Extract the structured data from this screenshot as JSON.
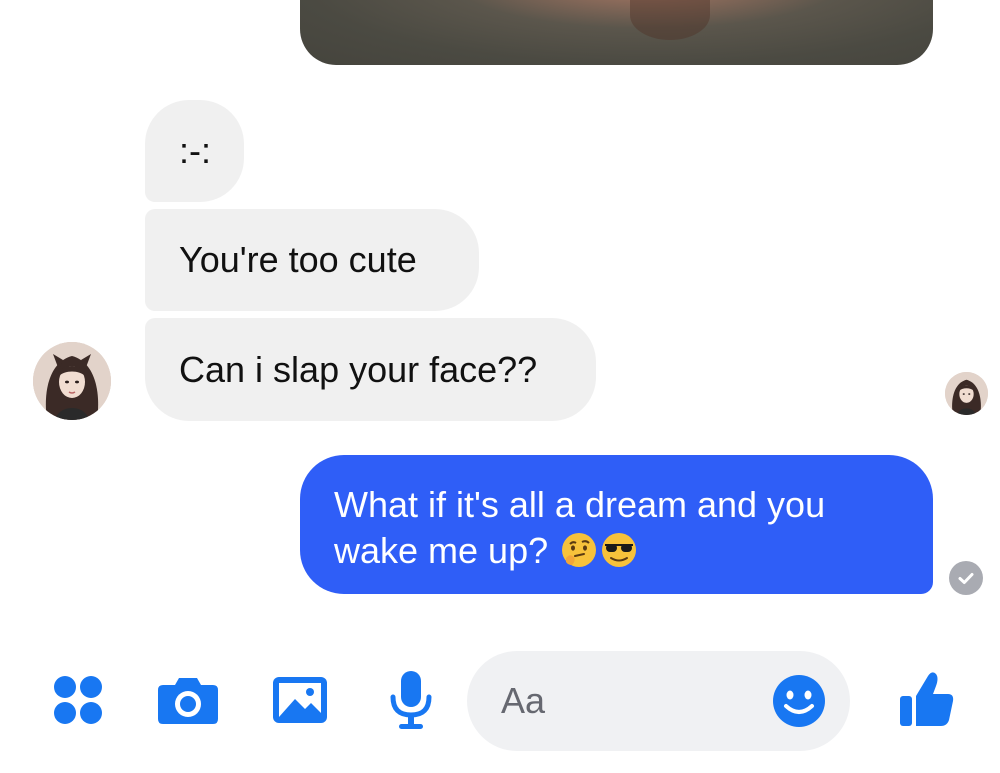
{
  "thread": {
    "incoming": [
      {
        "text": ":-:"
      },
      {
        "text": "You're too cute"
      },
      {
        "text": "Can i slap your face??"
      }
    ],
    "outgoing": {
      "line1": "What if it's all a dream and you",
      "line2": "wake me up?",
      "emojis": [
        "thinking-face",
        "smiling-face-with-sunglasses"
      ]
    },
    "status": "seen"
  },
  "composer": {
    "placeholder": "Aa",
    "tools": [
      "apps-grid-icon",
      "camera-icon",
      "gallery-icon",
      "microphone-icon",
      "emoji-icon",
      "like-thumb-icon"
    ]
  },
  "colors": {
    "accent": "#1877f2",
    "outgoing_bubble": "#2f5ef7",
    "incoming_bubble": "#f0f0f0",
    "composer_bg": "#f0f1f3"
  }
}
